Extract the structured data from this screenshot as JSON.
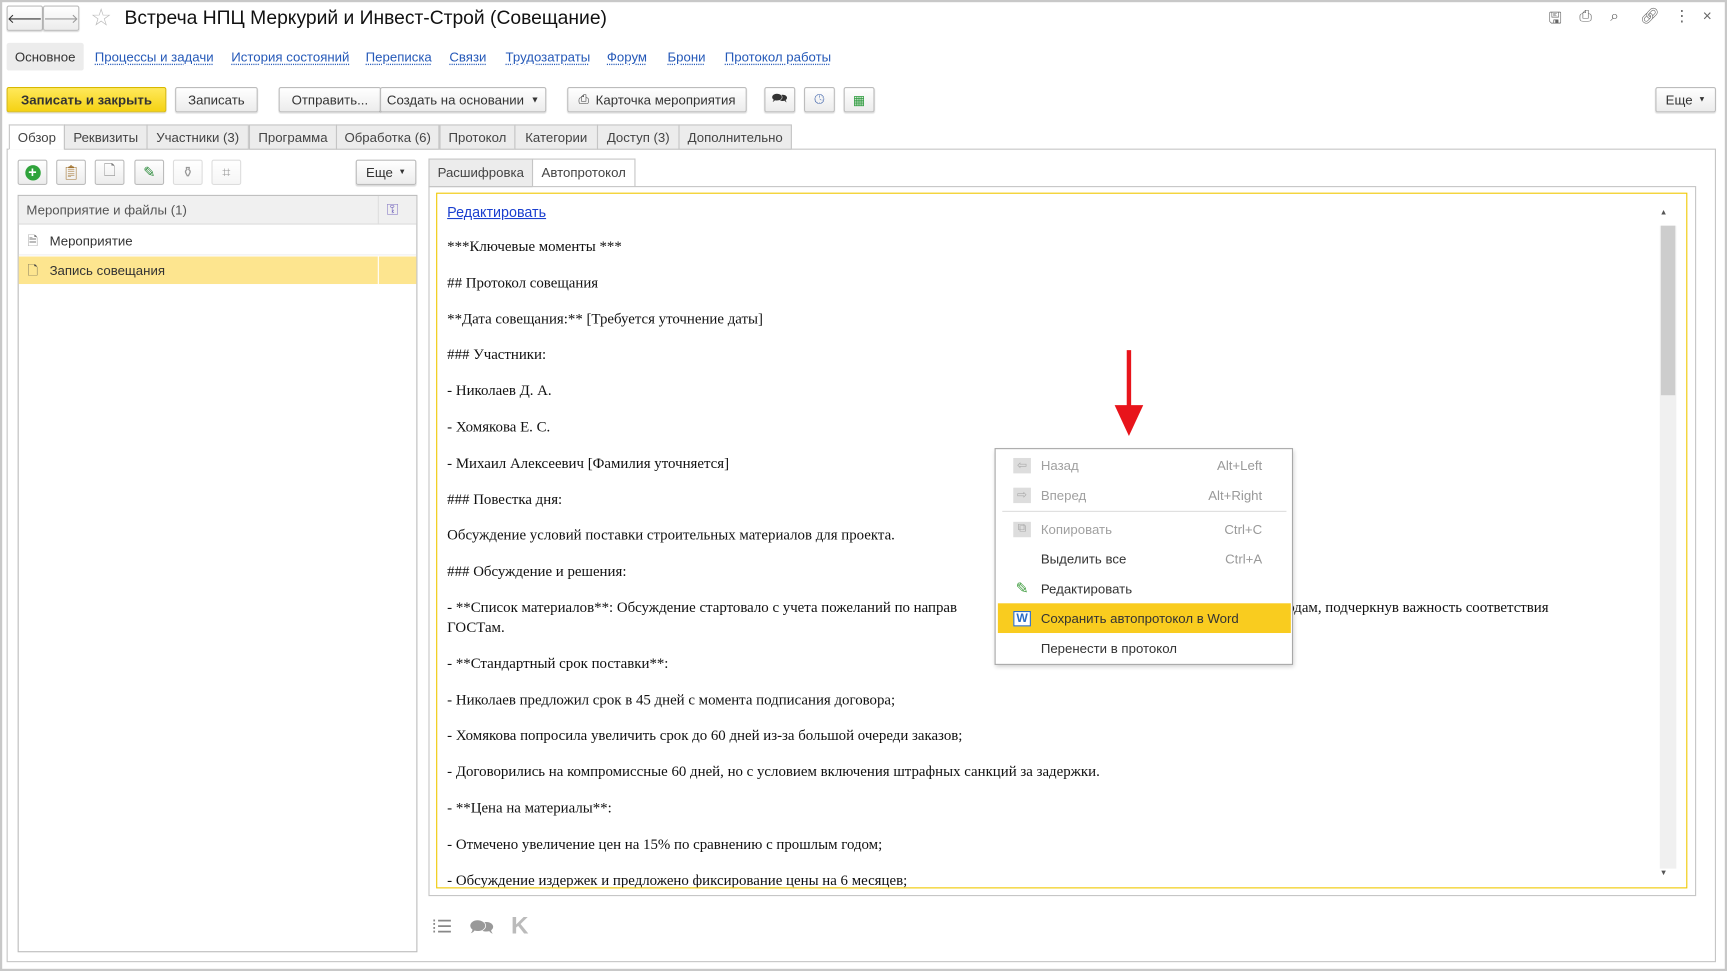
{
  "window": {
    "title": "Встреча НПЦ Меркурий и Инвест-Строй  (Совещание)"
  },
  "nav": {
    "active": "Основное",
    "links": [
      "Процессы и задачи",
      "История состояний",
      "Переписка",
      "Связи",
      "Трудозатраты",
      "Форум",
      "Брони",
      "Протокол работы"
    ]
  },
  "toolbar": {
    "save_close": "Записать и закрыть",
    "save": "Записать",
    "send": "Отправить...",
    "create_based": "Создать на основании",
    "event_card": "Карточка мероприятия",
    "more": "Еще"
  },
  "tabs": [
    "Обзор",
    "Реквизиты",
    "Участники (3)",
    "Программа",
    "Обработка (6)",
    "Протокол",
    "Категории",
    "Доступ (3)",
    "Дополнительно"
  ],
  "left": {
    "more": "Еще",
    "list_header": "Мероприятие и файлы (1)",
    "items": [
      "Мероприятие",
      "Запись совещания"
    ]
  },
  "right": {
    "subtabs": [
      "Расшифровка",
      "Автопротокол"
    ],
    "edit_link": "Редактировать",
    "lines": [
      "***Ключевые моменты ***",
      "## Протокол совещания",
      "**Дата совещания:** [Требуется уточнение даты]",
      "### Участники:",
      "- Николаев Д. А.",
      "- Хомякова Е. С.",
      "- Михаил Алексеевич [Фамилия уточняется]",
      "### Повестка дня:",
      "Обсуждение условий поставки строительных материалов для проекта.",
      "### Обсуждение и решения:"
    ],
    "wrapped": {
      "part1": "- **Список материалов**: Обсуждение стартовало с учета пожеланий по направ",
      "part2": "роводам, подчеркнув важность соответствия",
      "part3": "ГОСТам."
    },
    "lines2": [
      "- **Стандартный срок поставки**:",
      "- Николаев предложил срок в 45 дней с момента подписания договора;",
      "- Хомякова попросила увеличить срок до 60 дней из-за большой очереди заказов;",
      "- Договорились на компромиссные 60 дней, но с условием включения штрафных санкций за задержки.",
      "- **Цена на материалы**:",
      "- Отмечено увеличение цен на 15% по сравнению с прошлым годом;",
      "- Обсуждение издержек и предложено фиксирование цены на 6 месяцев;"
    ]
  },
  "context_menu": {
    "items": [
      {
        "label": "Назад",
        "shortcut": "Alt+Left",
        "disabled": true,
        "icon": "back-icon"
      },
      {
        "label": "Вперед",
        "shortcut": "Alt+Right",
        "disabled": true,
        "icon": "forward-icon"
      },
      {
        "label": "Копировать",
        "shortcut": "Ctrl+C",
        "disabled": true,
        "icon": "copy-icon"
      },
      {
        "label": "Выделить все",
        "shortcut": "Ctrl+A",
        "disabled": false
      },
      {
        "label": "Редактировать",
        "shortcut": "",
        "disabled": false,
        "icon": "pencil-icon"
      },
      {
        "label": "Сохранить автопротокол в Word",
        "shortcut": "",
        "disabled": false,
        "highlighted": true,
        "icon": "word-icon"
      },
      {
        "label": "Перенести в протокол",
        "shortcut": "",
        "disabled": false
      }
    ]
  },
  "colors": {
    "accent": "#f5d214",
    "highlight": "#f9cc1f",
    "row_selected": "#fde58f",
    "link": "#2458b8",
    "arrow": "#e8141b"
  }
}
